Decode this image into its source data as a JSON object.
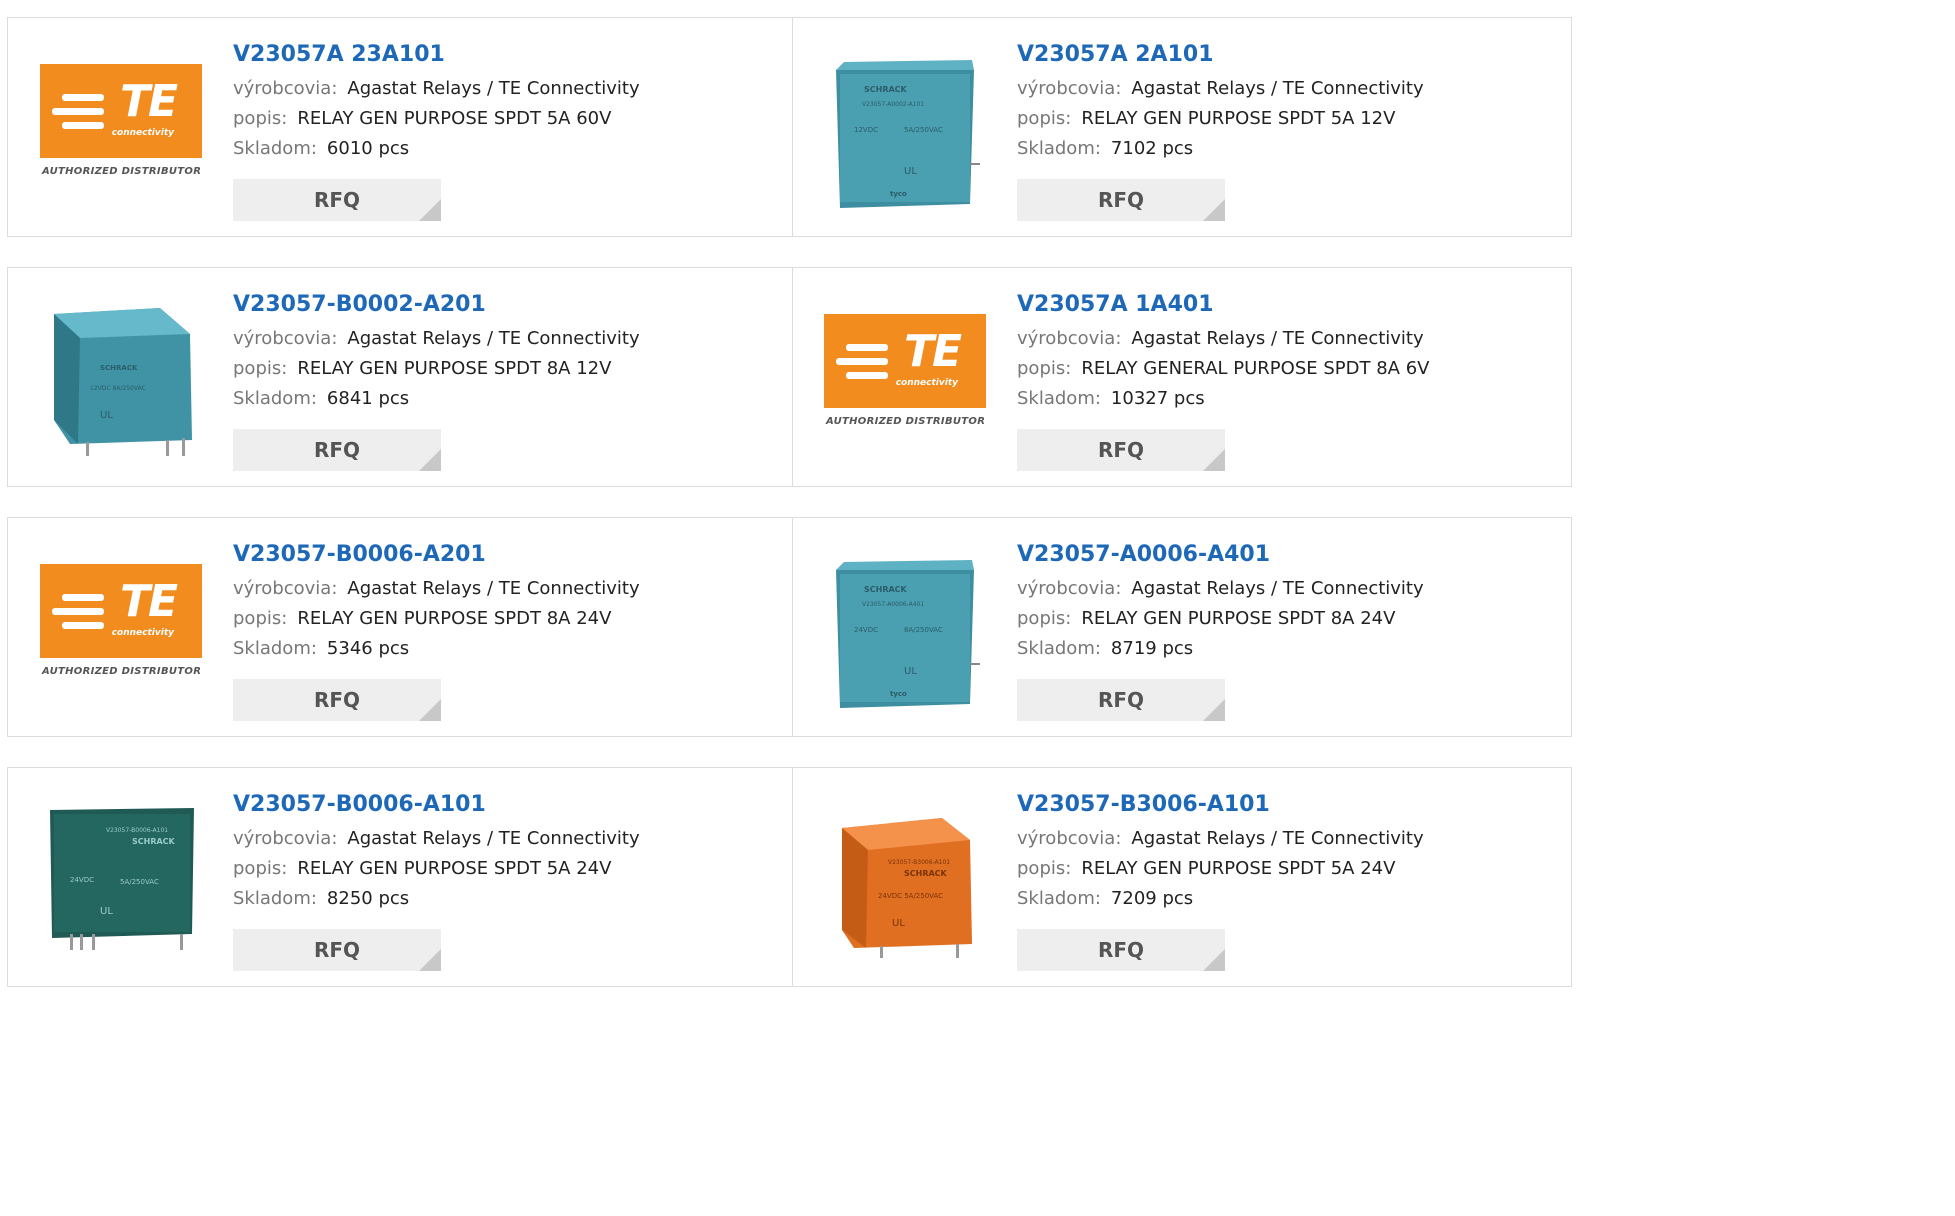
{
  "labels": {
    "manufacturer": "výrobcovia:",
    "description": "popis:",
    "stock": "Skladom:",
    "rfq": "RFQ"
  },
  "logo": {
    "brand": "TE",
    "tagline": "connectivity",
    "caption": "AUTHORIZED DISTRIBUTOR",
    "color": "#f28c1f"
  },
  "products": [
    {
      "part": "V23057A 23A101",
      "manufacturer": "Agastat Relays / TE Connectivity",
      "description": "RELAY GEN PURPOSE SPDT 5A 60V",
      "stock": "6010 pcs",
      "image": "te-logo"
    },
    {
      "part": "V23057A 2A101",
      "manufacturer": "Agastat Relays / TE Connectivity",
      "description": "RELAY GEN PURPOSE SPDT 5A 12V",
      "stock": "7102 pcs",
      "image": "blue-relay-icon"
    },
    {
      "part": "V23057-B0002-A201",
      "manufacturer": "Agastat Relays / TE Connectivity",
      "description": "RELAY GEN PURPOSE SPDT 8A 12V",
      "stock": "6841 pcs",
      "image": "blue-relay-icon"
    },
    {
      "part": "V23057A 1A401",
      "manufacturer": "Agastat Relays / TE Connectivity",
      "description": "RELAY GENERAL PURPOSE SPDT 8A 6V",
      "stock": "10327 pcs",
      "image": "te-logo"
    },
    {
      "part": "V23057-B0006-A201",
      "manufacturer": "Agastat Relays / TE Connectivity",
      "description": "RELAY GEN PURPOSE SPDT 8A 24V",
      "stock": "5346 pcs",
      "image": "te-logo"
    },
    {
      "part": "V23057-A0006-A401",
      "manufacturer": "Agastat Relays / TE Connectivity",
      "description": "RELAY GEN PURPOSE SPDT 8A 24V",
      "stock": "8719 pcs",
      "image": "blue-relay-icon"
    },
    {
      "part": "V23057-B0006-A101",
      "manufacturer": "Agastat Relays / TE Connectivity",
      "description": "RELAY GEN PURPOSE SPDT 5A 24V",
      "stock": "8250 pcs",
      "image": "green-relay-icon"
    },
    {
      "part": "V23057-B3006-A101",
      "manufacturer": "Agastat Relays / TE Connectivity",
      "description": "RELAY GEN PURPOSE SPDT 5A 24V",
      "stock": "7209 pcs",
      "image": "orange-relay-icon"
    }
  ],
  "colors": {
    "link": "#1e68b8",
    "border": "#dcdcdc",
    "button_bg": "#eeeeee",
    "relay_blue": "#4a9fb0",
    "relay_green": "#1f5a55",
    "relay_orange": "#e8782a"
  }
}
